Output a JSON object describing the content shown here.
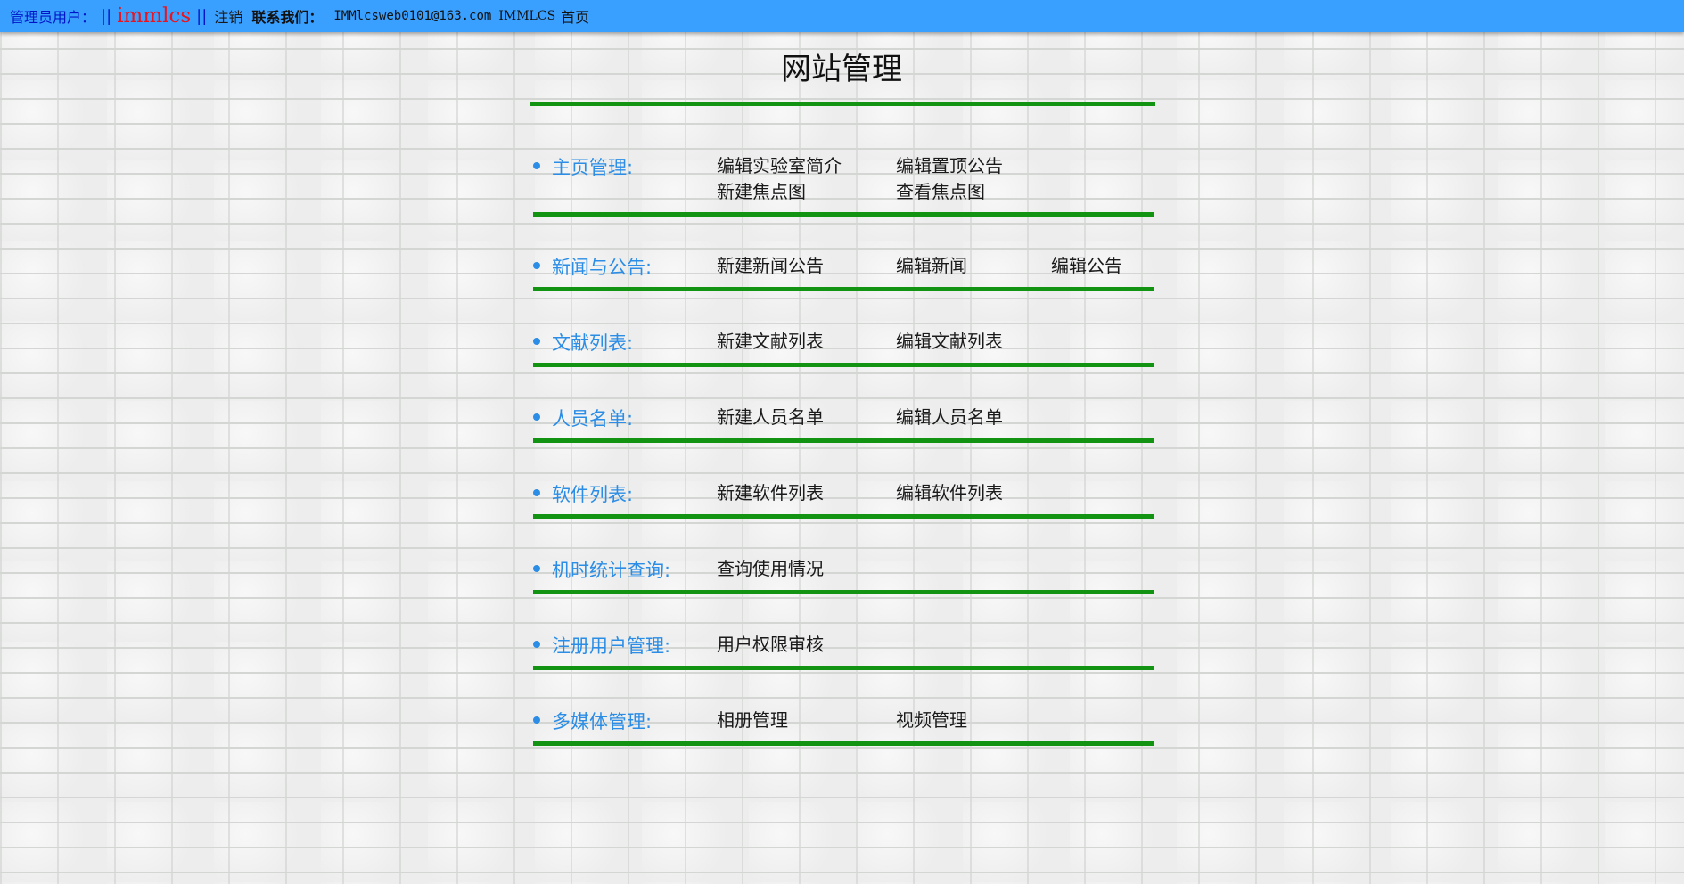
{
  "topbar": {
    "admin_label": "管理员用户：",
    "sep1": "||",
    "username": "immlcs",
    "sep2": "||",
    "logout": "注销",
    "contact_label": "联系我们：",
    "contact_email": "IMMlcsweb0101@163.com",
    "org": "IMMLCS",
    "home": "首页"
  },
  "page": {
    "title": "网站管理"
  },
  "sections": [
    {
      "label": "主页管理:",
      "links": [
        "编辑实验室简介",
        "编辑置顶公告",
        "新建焦点图",
        "查看焦点图"
      ]
    },
    {
      "label": "新闻与公告:",
      "links": [
        "新建新闻公告",
        "编辑新闻",
        "编辑公告"
      ]
    },
    {
      "label": "文献列表:",
      "links": [
        "新建文献列表",
        "编辑文献列表"
      ]
    },
    {
      "label": "人员名单:",
      "links": [
        "新建人员名单",
        "编辑人员名单"
      ]
    },
    {
      "label": "软件列表:",
      "links": [
        "新建软件列表",
        "编辑软件列表"
      ]
    },
    {
      "label": "机时统计查询:",
      "links": [
        "查询使用情况"
      ]
    },
    {
      "label": "注册用户管理:",
      "links": [
        "用户权限审核"
      ]
    },
    {
      "label": "多媒体管理:",
      "links": [
        "相册管理",
        "视频管理"
      ]
    }
  ],
  "colors": {
    "topbar_bg": "#3aa0ff",
    "section_label": "#2b8de6",
    "rule": "#129412",
    "username": "#e8141f"
  }
}
